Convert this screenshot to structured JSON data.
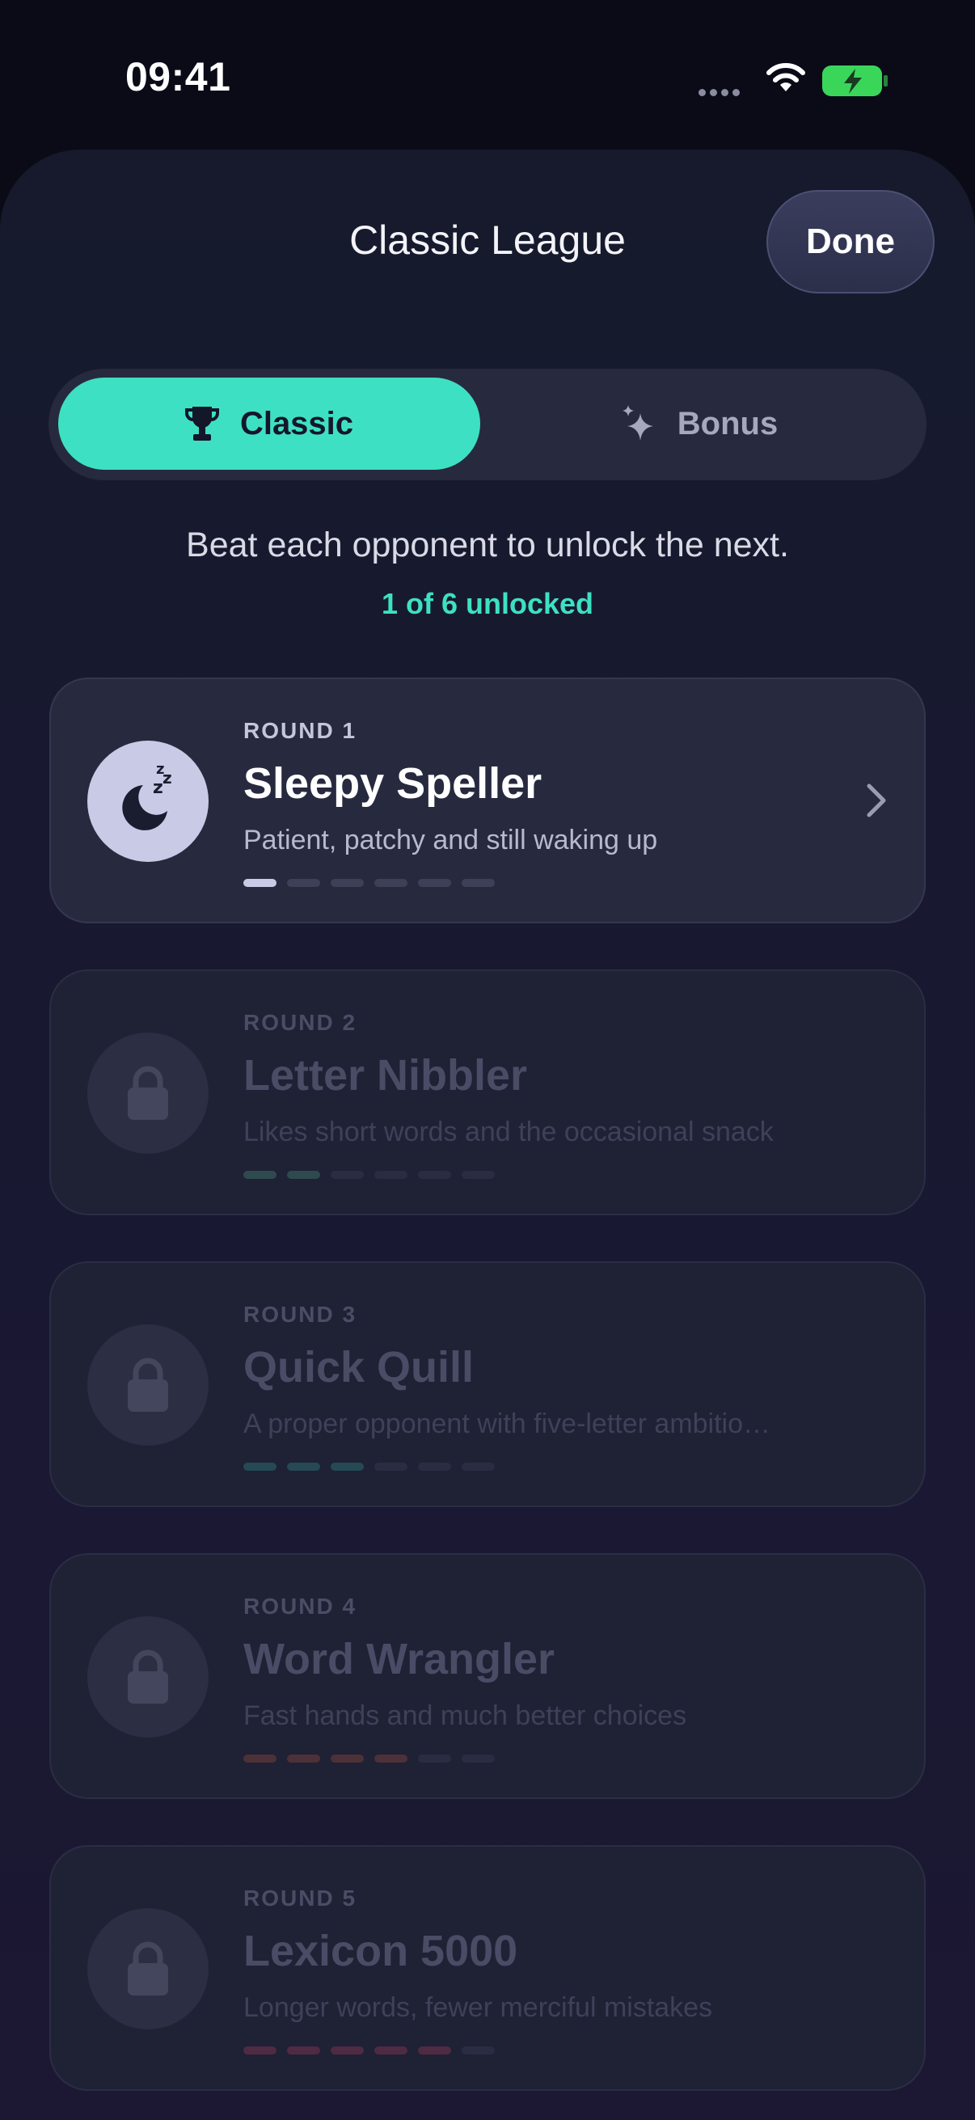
{
  "status_bar": {
    "time": "09:41"
  },
  "header": {
    "title": "Classic League",
    "done_label": "Done"
  },
  "tabs": [
    {
      "label": "Classic",
      "icon": "trophy-icon",
      "selected": true
    },
    {
      "label": "Bonus",
      "icon": "sparkle-icon",
      "selected": false
    }
  ],
  "intro": {
    "text": "Beat each opponent to unlock the next.",
    "progress": "1 of 6 unlocked"
  },
  "rounds": [
    {
      "label": "ROUND 1",
      "name": "Sleepy Speller",
      "description": "Patient, patchy and still waking up",
      "locked": false,
      "icon": "sleeping-moon-icon",
      "difficulty": 1,
      "accent": "#c9cbe6"
    },
    {
      "label": "ROUND 2",
      "name": "Letter Nibbler",
      "description": "Likes short words and the occasional snack",
      "locked": true,
      "icon": "lock-icon",
      "difficulty": 2,
      "accent": "#2f4a4f"
    },
    {
      "label": "ROUND 3",
      "name": "Quick Quill",
      "description": "A proper opponent with five-letter ambitio…",
      "locked": true,
      "icon": "lock-icon",
      "difficulty": 3,
      "accent": "#254a55"
    },
    {
      "label": "ROUND 4",
      "name": "Word Wrangler",
      "description": "Fast hands and much better choices",
      "locked": true,
      "icon": "lock-icon",
      "difficulty": 4,
      "accent": "#4d3138"
    },
    {
      "label": "ROUND 5",
      "name": "Lexicon 5000",
      "description": "Longer words, fewer merciful mistakes",
      "locked": true,
      "icon": "lock-icon",
      "difficulty": 5,
      "accent": "#4e2b42"
    }
  ],
  "colors": {
    "accent": "#3ee0c3",
    "background": "#0a0b16",
    "battery": "#3ad65a"
  }
}
